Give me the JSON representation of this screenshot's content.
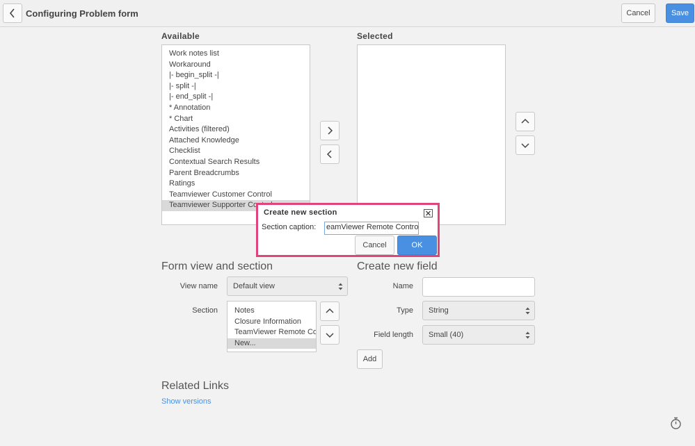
{
  "header": {
    "title": "Configuring Problem form",
    "cancel_label": "Cancel",
    "save_label": "Save"
  },
  "available": {
    "label": "Available",
    "items": [
      "Work notes list",
      "Workaround",
      "|- begin_split -|",
      "|- split -|",
      "|- end_split -|",
      "* Annotation",
      "* Chart",
      "Activities (filtered)",
      "Attached Knowledge",
      "Checklist",
      "Contextual Search Results",
      "Parent Breadcrumbs",
      "Ratings",
      "Teamviewer Customer Control",
      "Teamviewer Supporter Control"
    ],
    "selected_index": 14
  },
  "selected": {
    "label": "Selected",
    "items": []
  },
  "form_view": {
    "heading": "Form view and section",
    "view_name_label": "View name",
    "view_name_value": "Default view",
    "section_label": "Section",
    "sections": [
      "Notes",
      "Closure Information",
      "TeamViewer Remote Control",
      "New..."
    ],
    "selected_section_index": 3
  },
  "new_field": {
    "heading": "Create new field",
    "name_label": "Name",
    "name_value": "",
    "type_label": "Type",
    "type_value": "String",
    "length_label": "Field length",
    "length_value": "Small (40)",
    "add_label": "Add"
  },
  "related": {
    "heading": "Related Links",
    "show_versions": "Show versions"
  },
  "dialog": {
    "title": "Create new section",
    "caption_label": "Section caption:",
    "caption_value": "eamViewer Remote Control",
    "cancel_label": "Cancel",
    "ok_label": "OK",
    "highlight_color": "#e0447d"
  },
  "colors": {
    "accent": "#4a90e2",
    "background": "#f2f2f2"
  },
  "icons": {
    "back": "chevron-left-icon",
    "add": "chevron-right-icon",
    "remove": "chevron-left-icon",
    "up": "chevron-up-icon",
    "down": "chevron-down-icon",
    "close": "close-icon",
    "timer": "stopwatch-icon"
  }
}
